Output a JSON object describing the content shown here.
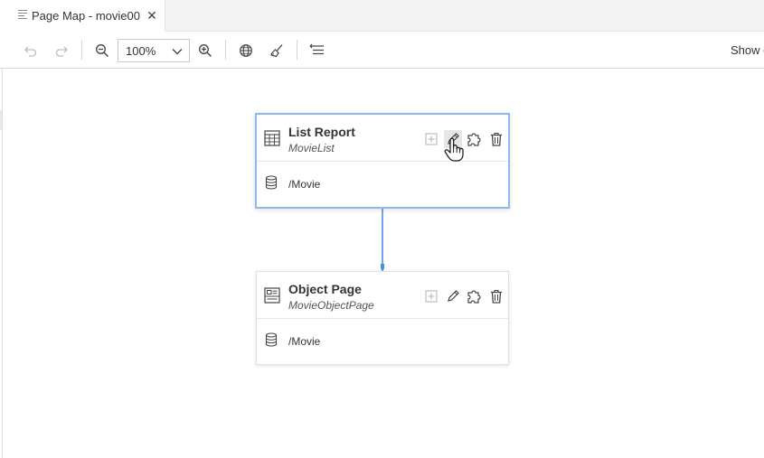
{
  "tab": {
    "title": "Page Map - movie00",
    "close_glyph": "✕",
    "icon": "document-lines-icon"
  },
  "toolbar": {
    "undo_icon": "undo-icon",
    "redo_icon": "redo-icon",
    "zoom_out_icon": "zoom-out-icon",
    "zoom_value": "100%",
    "zoom_in_icon": "zoom-in-icon",
    "globe_icon": "globe-icon",
    "broom_icon": "broom-icon",
    "layout_icon": "auto-layout-icon",
    "show_label": "Show c"
  },
  "pages": [
    {
      "title": "List Report",
      "subtitle": "MovieList",
      "entity": "/Movie",
      "type_icon": "table-icon",
      "selected": true
    },
    {
      "title": "Object Page",
      "subtitle": "MovieObjectPage",
      "entity": "/Movie",
      "type_icon": "object-page-icon",
      "selected": false
    }
  ],
  "colors": {
    "accent": "#4a90e2",
    "selected_border": "#8fb8ec",
    "icon_gray": "#555555"
  }
}
